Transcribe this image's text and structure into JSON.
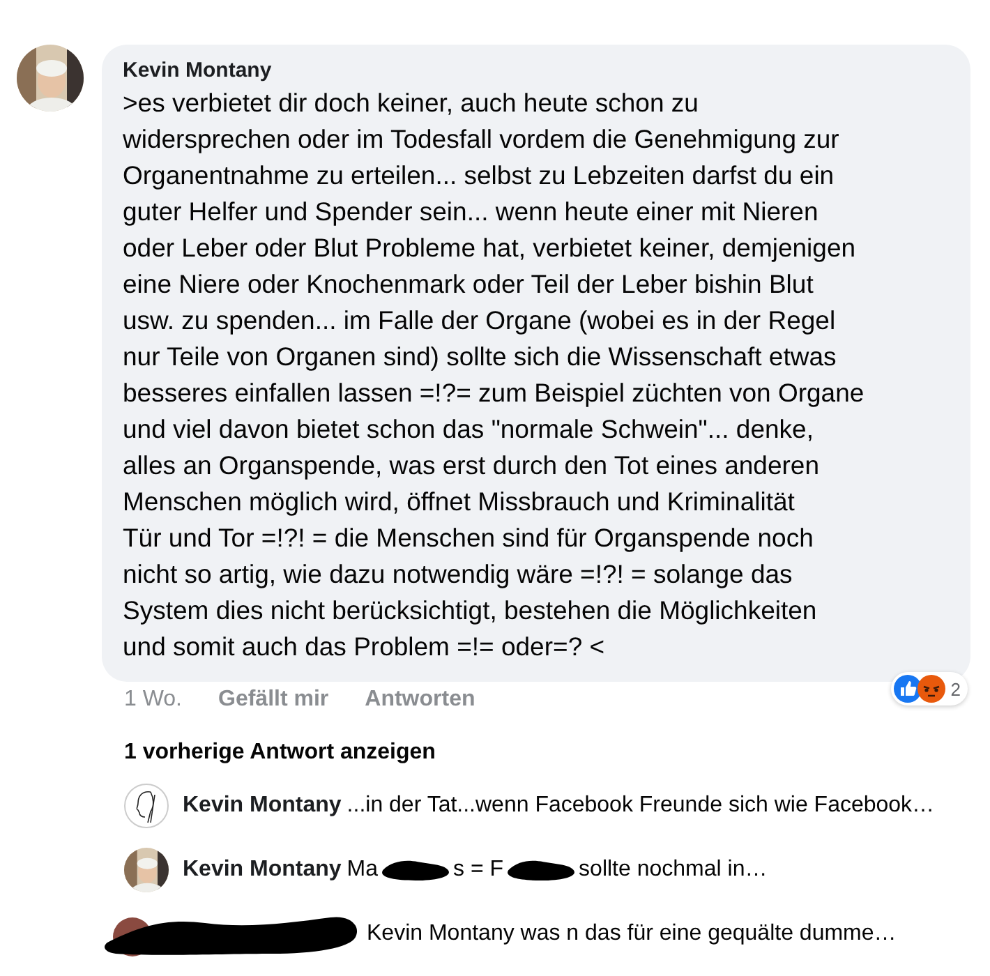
{
  "comment": {
    "author": "Kevin Montany",
    "text": ">es verbietet dir doch keiner, auch heute schon zu\nwidersprechen oder im Todesfall vordem die Genehmigung zur\nOrganentnahme zu erteilen... selbst zu Lebzeiten darfst du ein\nguter Helfer und Spender sein... wenn heute einer mit Nieren\noder Leber oder Blut Probleme hat, verbietet keiner, demjenigen\neine Niere oder Knochenmark oder Teil der Leber bishin Blut\nusw. zu spenden... im Falle der Organe (wobei es in der Regel\nnur Teile von Organen sind) sollte sich die Wissenschaft etwas\nbesseres einfallen lassen =!?= zum Beispiel züchten von Organe\nund viel davon bietet schon das \"normale Schwein\"... denke,\nalles an Organspende, was erst durch den Tot eines anderen\nMenschen möglich wird, öffnet  Missbrauch und Kriminalität\nTür und Tor =!?! = die Menschen sind für Organspende noch\nnicht so artig, wie dazu notwendig wäre =!?! = solange das\nSystem dies nicht berücksichtigt, bestehen die Möglichkeiten\nund somit auch das Problem =!= oder=? <",
    "time": "1 Wo.",
    "like": "Gefällt mir",
    "reply": "Antworten",
    "reactions": {
      "count": "2"
    }
  },
  "previous_replies": "1 vorherige Antwort anzeigen",
  "replies": [
    {
      "kind": "sketch",
      "author": "Kevin Montany",
      "parts": [
        "...in der Tat...wenn Facebook Freunde sich wie Facebook…"
      ]
    },
    {
      "author": "Kevin Montany",
      "parts": [
        "Ma",
        "s = F",
        "sollte nochmal in…"
      ]
    },
    {
      "kind": "redacted",
      "parts": [
        "Kevin Montany was n das für eine gequälte dumme…"
      ]
    }
  ]
}
